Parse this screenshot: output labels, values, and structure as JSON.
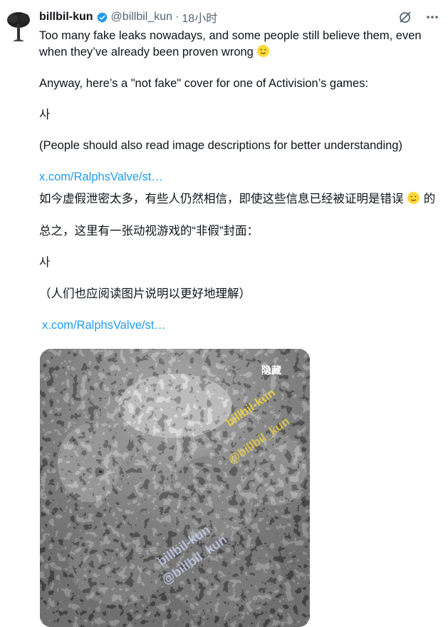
{
  "author": {
    "name": "billbil-kun",
    "handle": "@billbil_kun",
    "separator": "·",
    "time": "18小时"
  },
  "tweet": {
    "line1": "Too many fake leaks nowadays, and some people still believe them, even",
    "line2": "when they’ve already been proven wrong",
    "line3": "Anyway, here’s a \"not fake\" cover for one of Activision’s games:",
    "line4": "사",
    "line5": "(People should also read image descriptions for better understanding)",
    "link1": "x.com/RalphsValve/st…"
  },
  "translation": {
    "line1_pre": "如今虚假泄密太多，有些人仍然相信，即使这些信息已经被证明是错误",
    "line1_post": "的",
    "line2": "总之，这里有一张动视游戏的“非假”封面：",
    "line3": "사",
    "line4": "（人们也应阅读图片说明以更好地理解）",
    "link": "x.com/RalphsValve/st…"
  },
  "media": {
    "hide_label": "隐藏",
    "watermarks": [
      "billbil-kun",
      "@billbil_kun"
    ]
  },
  "icons": [
    "avatar",
    "verified-badge-icon",
    "grok-slash-icon",
    "more-icon",
    "smile-emoji-icon"
  ],
  "colors": {
    "link": "#1d9bf0",
    "verified": "#1d9bf0",
    "text": "#0f1419",
    "muted": "#536471"
  }
}
